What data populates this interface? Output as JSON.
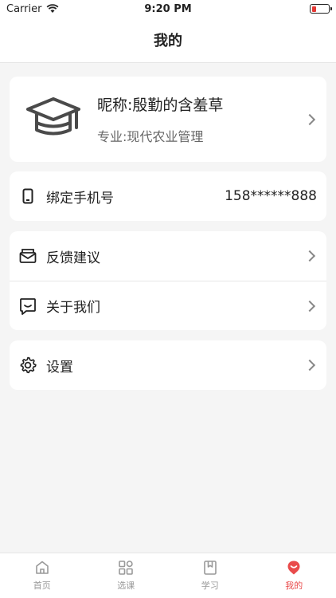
{
  "status": {
    "carrier": "Carrier",
    "time": "9:20 PM"
  },
  "header": {
    "title": "我的"
  },
  "profile": {
    "nickname": "昵称:殷勤的含羞草",
    "major": "专业:现代农业管理"
  },
  "phone": {
    "label": "绑定手机号",
    "value": "158******888"
  },
  "menu": [
    {
      "label": "反馈建议",
      "icon": "mail-icon"
    },
    {
      "label": "关于我们",
      "icon": "chat-icon"
    }
  ],
  "settings": {
    "label": "设置",
    "icon": "gear-icon"
  },
  "tabs": [
    {
      "label": "首页",
      "icon": "home-icon"
    },
    {
      "label": "选课",
      "icon": "grid-icon"
    },
    {
      "label": "学习",
      "icon": "book-icon"
    },
    {
      "label": "我的",
      "icon": "profile-icon",
      "active": true
    }
  ],
  "colors": {
    "accent": "#e94b4b",
    "background": "#f5f5f5"
  }
}
